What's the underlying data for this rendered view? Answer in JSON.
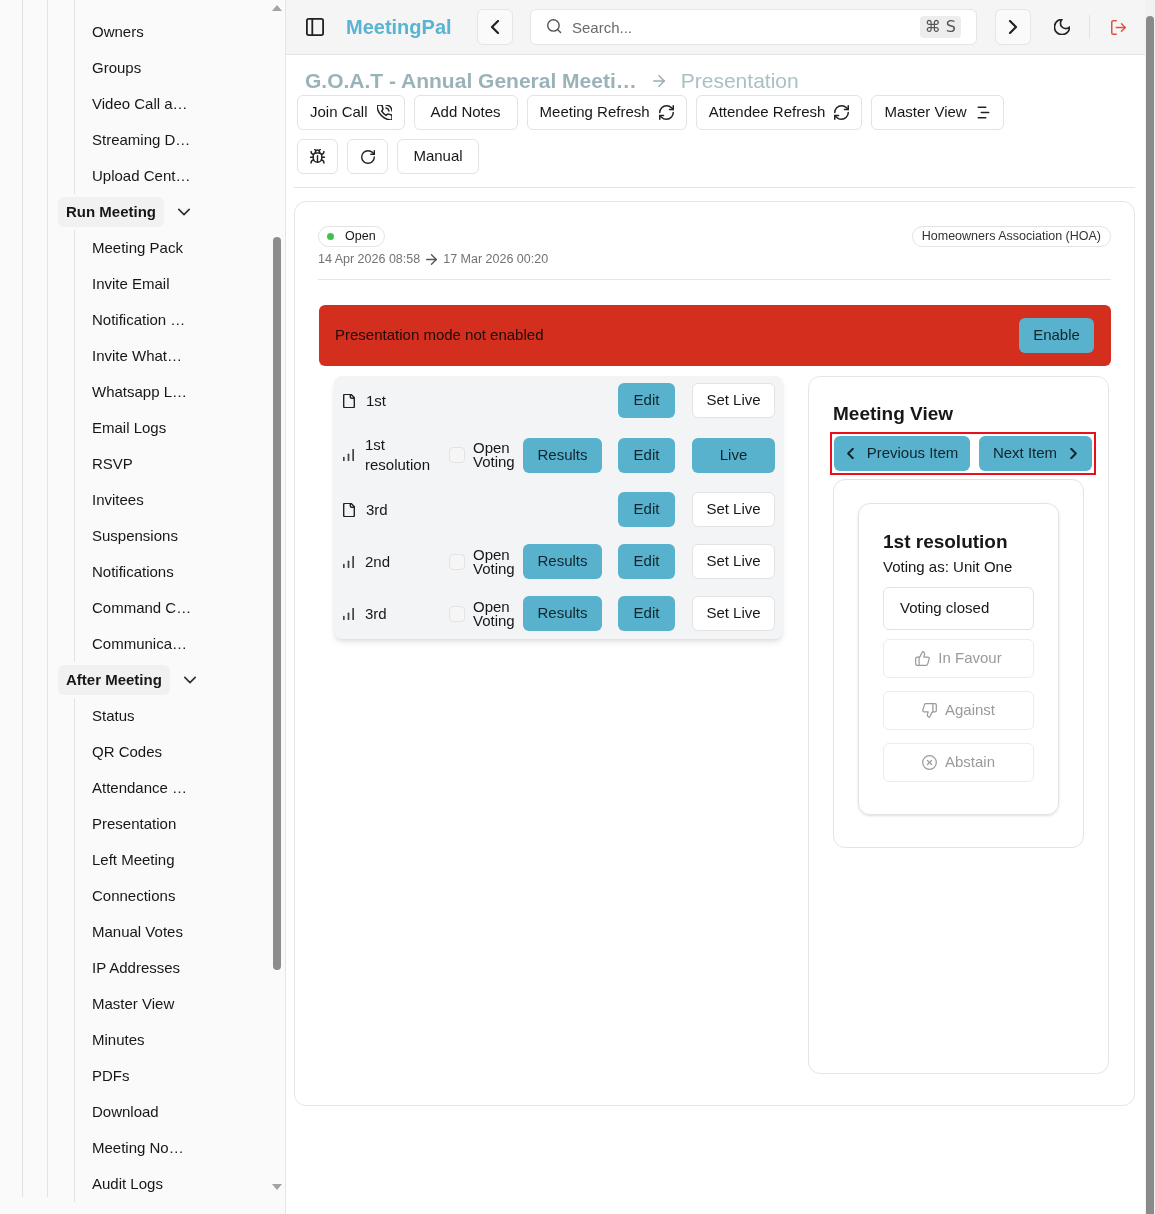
{
  "sidebar": {
    "items": [
      "Owners",
      "Groups",
      "Video Call a…",
      "Streaming D…",
      "Upload Cent…"
    ],
    "groups": [
      {
        "label": "Run Meeting",
        "expanded": true,
        "children": [
          "Meeting Pack",
          "Invite Email",
          "Notification …",
          "Invite What…",
          "Whatsapp L…",
          "Email Logs",
          "RSVP",
          "Invitees",
          "Suspensions",
          "Notifications",
          "Command C…",
          "Communica…"
        ]
      },
      {
        "label": "After Meeting",
        "expanded": true,
        "children": [
          "Status",
          "QR Codes",
          "Attendance …",
          "Presentation",
          "Left Meeting",
          "Connections",
          "Manual Votes",
          "IP Addresses",
          "Master View",
          "Minutes",
          "PDFs",
          "Download",
          "Meeting No…",
          "Audit Logs"
        ]
      }
    ]
  },
  "header": {
    "brand": "MeetingPal",
    "search": {
      "placeholder": "Search...",
      "shortcut": "⌘ S"
    }
  },
  "breadcrumb": [
    "G.O.A.T - Annual General Meeti…",
    "Presentation"
  ],
  "toolbar": {
    "row_1": [
      "Join Call",
      "Add Notes",
      "Meeting Refresh",
      "Attendee Refresh",
      "Master View"
    ],
    "row_2": [
      "Manual"
    ]
  },
  "meeting": {
    "status": "Open",
    "start": "14 Apr 2026 08:58",
    "end": "17 Mar 2026 00:20",
    "organisation": "Homeowners Association (HOA)"
  },
  "alert": {
    "message": "Presentation mode not enabled",
    "button": "Enable"
  },
  "items": [
    {
      "kind": "document",
      "title": "1st",
      "edit": "Edit",
      "live_button": "Set Live",
      "live": false
    },
    {
      "kind": "resolution",
      "title": "1st resolution",
      "voting": {
        "label": "Open Voting",
        "checked": false
      },
      "results": "Results",
      "edit": "Edit",
      "live_button": "Live",
      "live": true
    },
    {
      "kind": "document",
      "title": "3rd",
      "edit": "Edit",
      "live_button": "Set Live",
      "live": false
    },
    {
      "kind": "resolution",
      "title": "2nd",
      "voting": {
        "label": "Open Voting",
        "checked": false
      },
      "results": "Results",
      "edit": "Edit",
      "live_button": "Set Live",
      "live": false
    },
    {
      "kind": "resolution",
      "title": "3rd",
      "voting": {
        "label": "Open Voting",
        "checked": false
      },
      "results": "Results",
      "edit": "Edit",
      "live_button": "Set Live",
      "live": false
    }
  ],
  "meeting_view": {
    "title": "Meeting View",
    "previous": "Previous Item",
    "next": "Next Item",
    "highlighted": true,
    "card": {
      "title": "1st resolution",
      "voter": "Voting as: Unit One",
      "status": "Voting closed",
      "options": [
        {
          "kind": "favour",
          "label": "In Favour",
          "disabled": true
        },
        {
          "kind": "against",
          "label": "Against",
          "disabled": true
        },
        {
          "kind": "abstain",
          "label": "Abstain",
          "disabled": true
        }
      ]
    }
  }
}
